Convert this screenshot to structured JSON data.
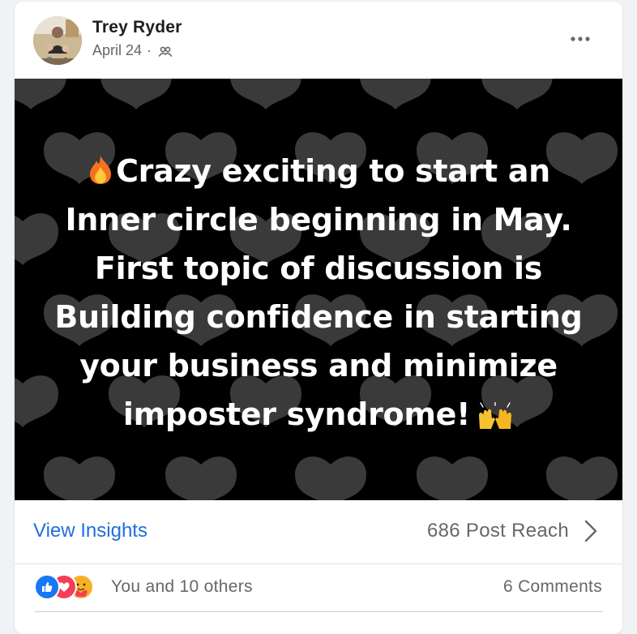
{
  "post": {
    "author": "Trey Ryder",
    "date": "April 24",
    "separator": "·",
    "audience_icon": "friends-icon",
    "more_icon": "more-horizontal-icon"
  },
  "media": {
    "background": "#000000",
    "pattern_icon": "heart-icon",
    "text_lines": [
      "Crazy exciting to start an",
      "Inner circle beginning in May.",
      "First topic of discussion is",
      "Building confidence in starting",
      "your business and minimize",
      "imposter syndrome!"
    ],
    "lead_emoji": "fire-emoji",
    "trail_emoji": "raising-hands-emoji"
  },
  "insights": {
    "link_label": "View Insights",
    "reach_label": "686 Post Reach",
    "link_color": "#216fdb"
  },
  "engagement": {
    "reactions": [
      "like-icon",
      "love-icon",
      "care-icon"
    ],
    "reactors_label": "You and 10 others",
    "comments_label": "6 Comments"
  }
}
